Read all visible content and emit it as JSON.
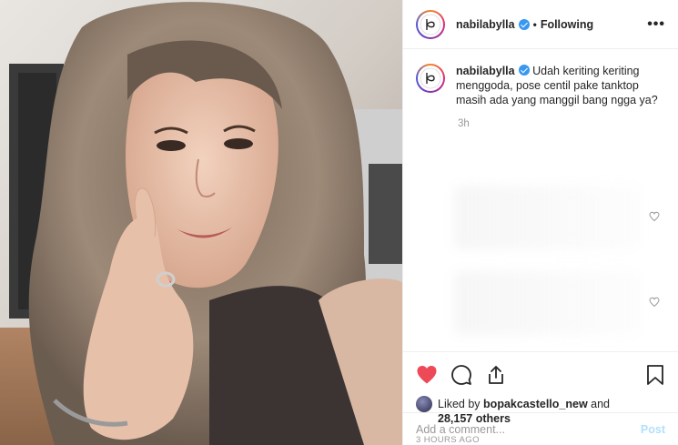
{
  "header": {
    "username": "nabilabylla",
    "verified_icon": "verified-badge-icon",
    "separator": "•",
    "follow_status": "Following",
    "more_label": "•••"
  },
  "photo": {
    "subject": "selfie-photo"
  },
  "caption": {
    "username": "nabilabylla",
    "text": "Udah keriting keriting menggoda, pose centil pake tanktop masih ada yang manggil bang ngga ya?",
    "time": "3h"
  },
  "actions": {
    "like_icon": "heart-filled-icon",
    "comment_icon": "comment-icon",
    "share_icon": "share-icon",
    "save_icon": "bookmark-icon",
    "like_color": "#ed4956"
  },
  "likes": {
    "prefix": "Liked by",
    "user": "bopakcastello_new",
    "joiner": "and",
    "others": "28,157 others"
  },
  "timestamp": "3 HOURS AGO",
  "comment_box": {
    "placeholder": "Add a comment...",
    "post_label": "Post"
  }
}
